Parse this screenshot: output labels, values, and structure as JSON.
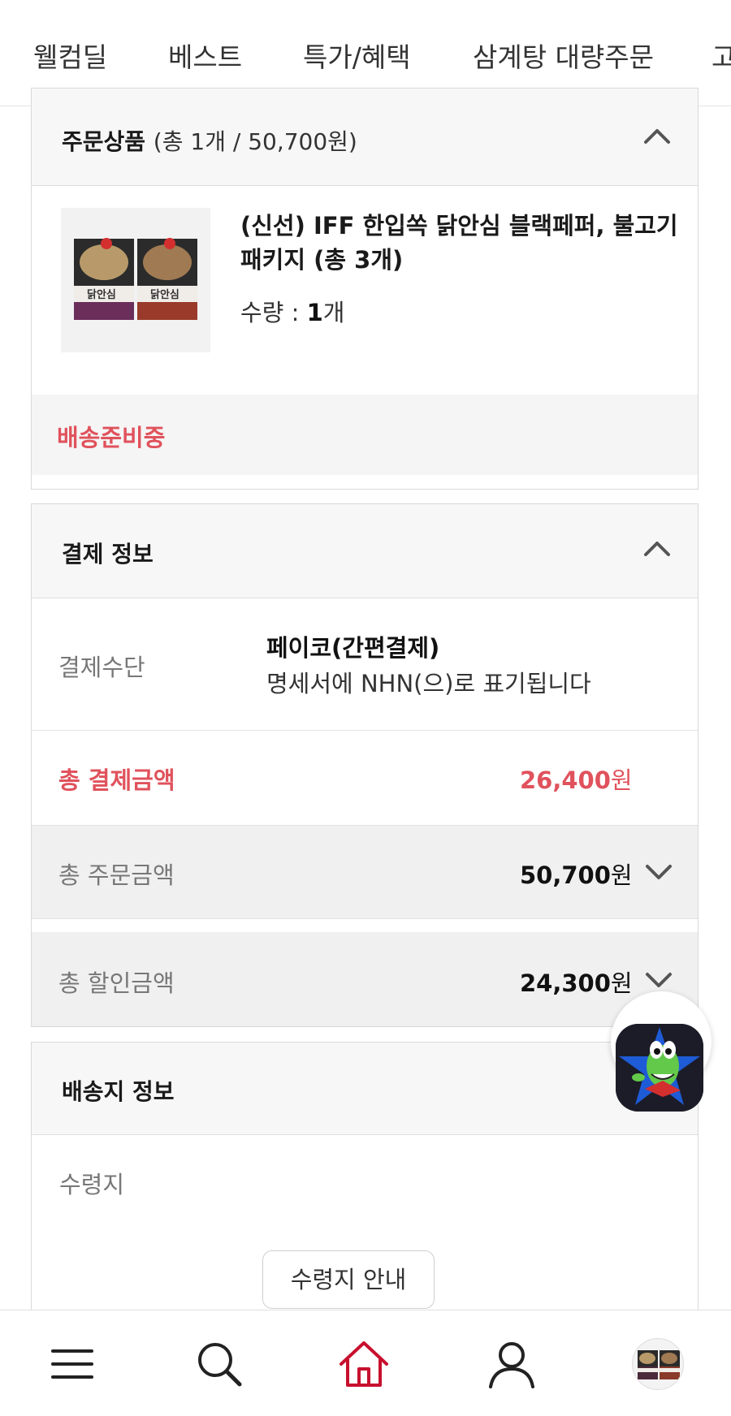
{
  "top_nav": {
    "tabs": [
      "웰컴딜",
      "베스트",
      "특가/혜택",
      "삼계탕 대량주문",
      "고"
    ]
  },
  "order_products": {
    "title": "주문상품",
    "summary": "(총 1개 / 50,700원)",
    "product": {
      "name": "(신선) IFF 한입쏙 닭안심 블랙페퍼, 불고기 패키지 (총 3개)",
      "qty_label": "수량 :",
      "qty_value": "1",
      "qty_unit": "개",
      "thumb_text": "닭안심"
    },
    "status": "배송준비중"
  },
  "payment_info": {
    "title": "결제 정보",
    "method_label": "결제수단",
    "method_value": "페이코(간편결제)",
    "method_note": "명세서에 NHN(으)로 표기됩니다",
    "total_paid_label": "총 결제금액",
    "total_paid_value": "26,400",
    "total_order_label": "총 주문금액",
    "total_order_value": "50,700",
    "total_discount_label": "총 할인금액",
    "total_discount_value": "24,300",
    "currency": "원"
  },
  "shipping_info": {
    "title": "배송지 정보",
    "receiver_label": "수령지",
    "guide_button": "수령지 안내"
  },
  "colors": {
    "accent_red": "#e0525c",
    "home_icon_red": "#c8102e"
  },
  "bottom_nav": {
    "icons": [
      "menu-icon",
      "search-icon",
      "home-icon",
      "user-icon",
      "recent-product-thumbnail"
    ]
  }
}
